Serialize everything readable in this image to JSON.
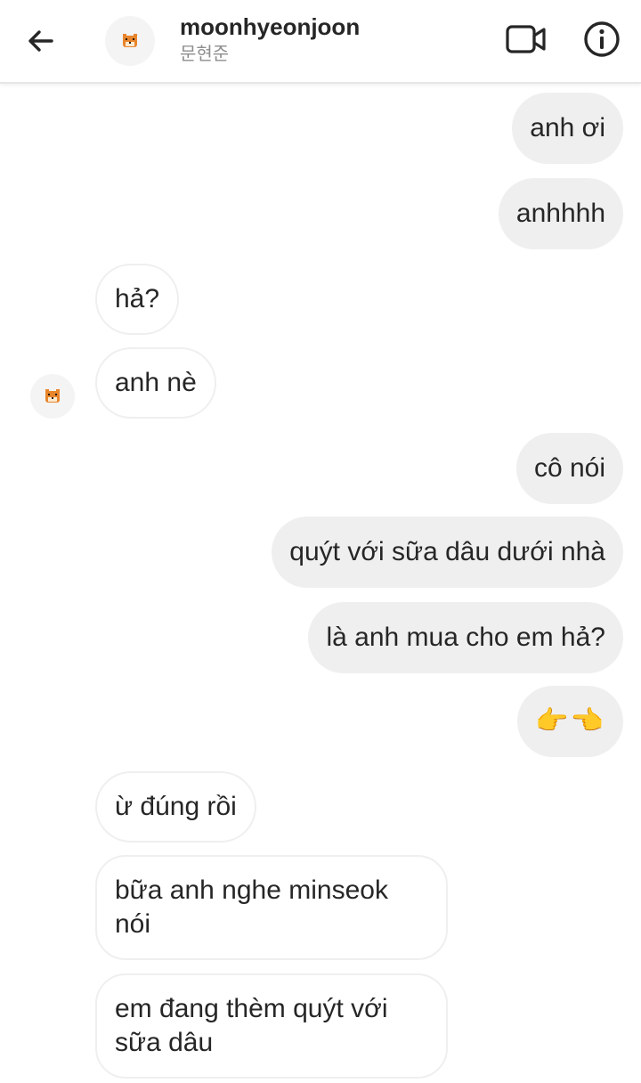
{
  "header": {
    "title": "moonhyeonjoon",
    "subtitle": "문현준"
  },
  "icons": {
    "back": "arrow-left-icon",
    "video": "video-camera-icon",
    "info": "info-circle-icon",
    "avatar": "tiger-avatar-icon"
  },
  "colors": {
    "sent_bubble": "#efefef",
    "received_border": "#efefef",
    "text": "#262626",
    "subtitle": "#8e8e8e"
  },
  "messages": [
    {
      "side": "sent",
      "text": "anh ơi"
    },
    {
      "side": "sent",
      "text": "anhhhh"
    },
    {
      "side": "received",
      "text": "hả?"
    },
    {
      "side": "received",
      "text": "anh nè"
    },
    {
      "side": "sent",
      "text": "cô nói"
    },
    {
      "side": "sent",
      "text": "quýt với sữa dâu dưới nhà"
    },
    {
      "side": "sent",
      "text": "là anh mua cho em hả?"
    },
    {
      "side": "sent",
      "text": "👉👈"
    },
    {
      "side": "received",
      "text": "ừ đúng rồi"
    },
    {
      "side": "received",
      "text": "bữa anh nghe minseok nói"
    },
    {
      "side": "received",
      "text": "em đang thèm quýt với sữa dâu"
    }
  ]
}
